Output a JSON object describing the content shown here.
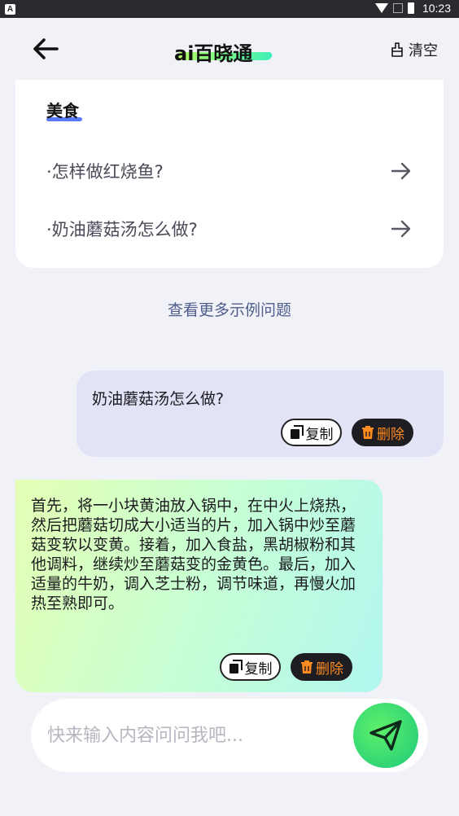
{
  "status_bar": {
    "time": "10:23",
    "app_badge": "A"
  },
  "header": {
    "logo_text": "ai百晓通",
    "clear_label": "清空"
  },
  "category_card": {
    "title": "美食",
    "questions": [
      {
        "text": "·怎样做红烧鱼?"
      },
      {
        "text": "·奶油蘑菇汤怎么做?"
      }
    ]
  },
  "more_examples_label": "查看更多示例问题",
  "conversation": {
    "user_message": "奶油蘑菇汤怎么做?",
    "ai_message": "首先，将一小块黄油放入锅中，在中火上烧热，然后把蘑菇切成大小适当的片，加入锅中炒至蘑菇变软以变黄。接着，加入食盐，黑胡椒粉和其他调料，继续炒至蘑菇变的金黄色。最后，加入适量的牛奶，调入芝士粉，调节味道，再慢火加热至熟即可。",
    "copy_label": "复制",
    "delete_label": "删除"
  },
  "input": {
    "placeholder": "快来输入内容问问我吧...",
    "value": ""
  },
  "colors": {
    "accent_green": "#1fc97a",
    "delete_text": "#ff8a1f",
    "user_bubble": "#e2e3f7"
  }
}
